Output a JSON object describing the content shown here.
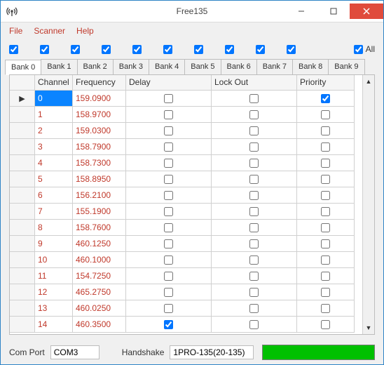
{
  "title": "Free135",
  "menu": {
    "file": "File",
    "scanner": "Scanner",
    "help": "Help"
  },
  "bankChecks": {
    "count": 10,
    "checked": [
      true,
      true,
      true,
      true,
      true,
      true,
      true,
      true,
      true,
      true
    ],
    "allLabel": "All",
    "allChecked": true
  },
  "tabs": [
    {
      "label": "Bank 0",
      "active": true
    },
    {
      "label": "Bank 1",
      "active": false
    },
    {
      "label": "Bank 2",
      "active": false
    },
    {
      "label": "Bank 3",
      "active": false
    },
    {
      "label": "Bank 4",
      "active": false
    },
    {
      "label": "Bank 5",
      "active": false
    },
    {
      "label": "Bank 6",
      "active": false
    },
    {
      "label": "Bank 7",
      "active": false
    },
    {
      "label": "Bank 8",
      "active": false
    },
    {
      "label": "Bank 9",
      "active": false
    }
  ],
  "columns": {
    "rowSel": "",
    "channel": "Channel",
    "frequency": "Frequency",
    "delay": "Delay",
    "lockout": "Lock Out",
    "priority": "Priority"
  },
  "rows": [
    {
      "current": true,
      "selected": true,
      "channel": "0",
      "frequency": "159.0900",
      "delay": false,
      "lockout": false,
      "priority": true
    },
    {
      "current": false,
      "selected": false,
      "channel": "1",
      "frequency": "158.9700",
      "delay": false,
      "lockout": false,
      "priority": false
    },
    {
      "current": false,
      "selected": false,
      "channel": "2",
      "frequency": "159.0300",
      "delay": false,
      "lockout": false,
      "priority": false
    },
    {
      "current": false,
      "selected": false,
      "channel": "3",
      "frequency": "158.7900",
      "delay": false,
      "lockout": false,
      "priority": false
    },
    {
      "current": false,
      "selected": false,
      "channel": "4",
      "frequency": "158.7300",
      "delay": false,
      "lockout": false,
      "priority": false
    },
    {
      "current": false,
      "selected": false,
      "channel": "5",
      "frequency": "158.8950",
      "delay": false,
      "lockout": false,
      "priority": false
    },
    {
      "current": false,
      "selected": false,
      "channel": "6",
      "frequency": "156.2100",
      "delay": false,
      "lockout": false,
      "priority": false
    },
    {
      "current": false,
      "selected": false,
      "channel": "7",
      "frequency": "155.1900",
      "delay": false,
      "lockout": false,
      "priority": false
    },
    {
      "current": false,
      "selected": false,
      "channel": "8",
      "frequency": "158.7600",
      "delay": false,
      "lockout": false,
      "priority": false
    },
    {
      "current": false,
      "selected": false,
      "channel": "9",
      "frequency": "460.1250",
      "delay": false,
      "lockout": false,
      "priority": false
    },
    {
      "current": false,
      "selected": false,
      "channel": "10",
      "frequency": "460.1000",
      "delay": false,
      "lockout": false,
      "priority": false
    },
    {
      "current": false,
      "selected": false,
      "channel": "11",
      "frequency": "154.7250",
      "delay": false,
      "lockout": false,
      "priority": false
    },
    {
      "current": false,
      "selected": false,
      "channel": "12",
      "frequency": "465.2750",
      "delay": false,
      "lockout": false,
      "priority": false
    },
    {
      "current": false,
      "selected": false,
      "channel": "13",
      "frequency": "460.0250",
      "delay": false,
      "lockout": false,
      "priority": false
    },
    {
      "current": false,
      "selected": false,
      "channel": "14",
      "frequency": "460.3500",
      "delay": true,
      "lockout": false,
      "priority": false
    }
  ],
  "bottom": {
    "comPortLabel": "Com Port",
    "comPortValue": "COM3",
    "handshakeLabel": "Handshake",
    "handshakeValue": "1PRO-135(20-135)"
  }
}
